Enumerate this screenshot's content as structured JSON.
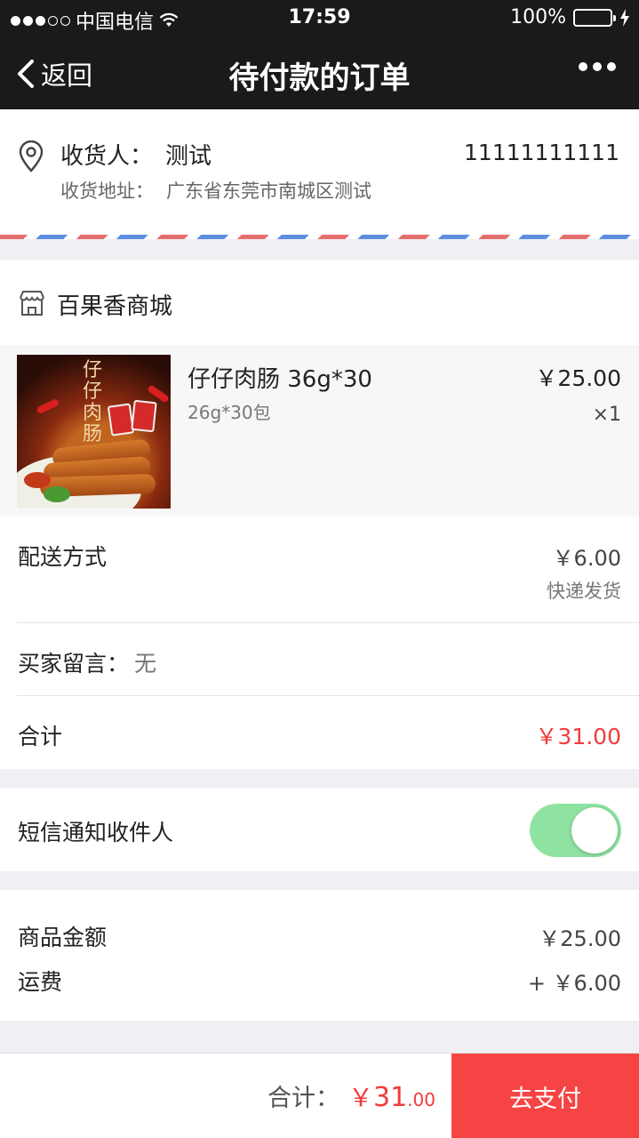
{
  "status_bar": {
    "carrier": "中国电信",
    "time": "17:59",
    "battery": "100%"
  },
  "nav": {
    "back_label": "返回",
    "title": "待付款的订单"
  },
  "address": {
    "receiver_label": "收货人：",
    "receiver_name": "测试",
    "phone": "11111111111",
    "address_label": "收货地址：",
    "address_value": "广东省东莞市南城区测试"
  },
  "shop": {
    "name": "百果香商城"
  },
  "product": {
    "name": "仔仔肉肠 36g*30",
    "spec": "26g*30包",
    "price": "￥25.00",
    "qty": "×1",
    "image_text": "仔仔肉肠"
  },
  "details": {
    "shipping_label": "配送方式",
    "shipping_price": "￥6.00",
    "shipping_method": "快递发货",
    "message_label": "买家留言：",
    "message_value": "无",
    "total_label": "合计",
    "total_value": "￥31.00"
  },
  "sms": {
    "label": "短信通知收件人",
    "enabled": true
  },
  "summary": {
    "goods_label": "商品金额",
    "goods_value": "￥25.00",
    "freight_label": "运费",
    "freight_value": "+ ￥6.00"
  },
  "bottom": {
    "total_label": "合计：",
    "total_currency": "￥",
    "total_int": "31",
    "total_dec": ".00",
    "pay_label": "去支付"
  },
  "colors": {
    "nav_bg": "#1a1a1c",
    "accent_red": "#f23b3b",
    "pay_button": "#f64444",
    "toggle_on": "#8fe3a1"
  }
}
